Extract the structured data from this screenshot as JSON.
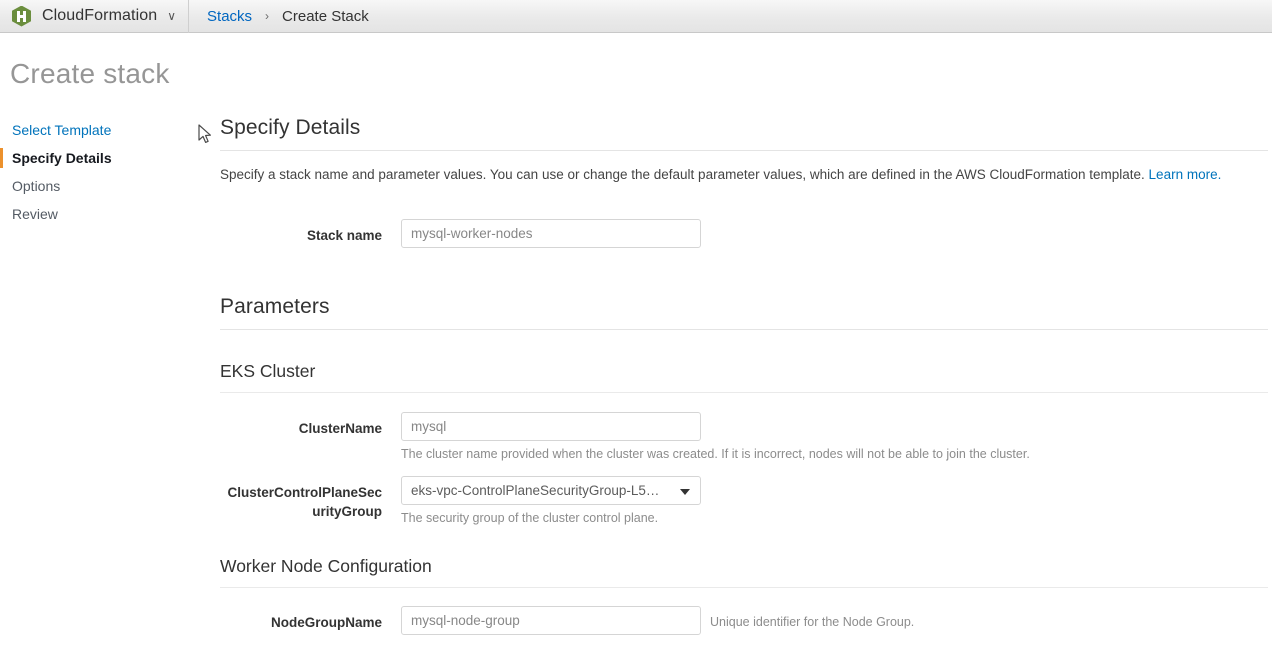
{
  "topbar": {
    "service_icon": "cloudformation-icon",
    "service_name": "CloudFormation",
    "service_caret": "∨",
    "breadcrumb": {
      "root_label": "Stacks",
      "separator": "›",
      "current_label": "Create Stack"
    }
  },
  "page": {
    "title": "Create stack"
  },
  "sidebar": {
    "items": [
      {
        "label": "Select Template",
        "state": "link"
      },
      {
        "label": "Specify Details",
        "state": "active"
      },
      {
        "label": "Options",
        "state": "normal"
      },
      {
        "label": "Review",
        "state": "normal"
      }
    ]
  },
  "main": {
    "section_title": "Specify Details",
    "intro_text": "Specify a stack name and parameter values. You can use or change the default parameter values, which are defined in the AWS CloudFormation template. ",
    "intro_link": "Learn more.",
    "stack_name": {
      "label": "Stack name",
      "value": "mysql-worker-nodes"
    },
    "parameters_title": "Parameters",
    "groups": [
      {
        "title": "EKS Cluster",
        "fields": [
          {
            "label": "ClusterName",
            "type": "text",
            "value": "mysql",
            "help": "The cluster name provided when the cluster was created. If it is incorrect, nodes will not be able to join the cluster.",
            "help_position": "below"
          },
          {
            "label": "ClusterControlPlaneSecurityGroup",
            "type": "select",
            "value": "eks-vpc-ControlPlaneSecurityGroup-L5…",
            "help": "The security group of the cluster control plane.",
            "help_position": "below"
          }
        ]
      },
      {
        "title": "Worker Node Configuration",
        "fields": [
          {
            "label": "NodeGroupName",
            "type": "text",
            "value": "mysql-node-group",
            "help": "Unique identifier for the Node Group.",
            "help_position": "right"
          }
        ]
      }
    ]
  },
  "colors": {
    "link": "#0073bb",
    "breadcrumb_link": "#0066c0",
    "accent_active": "#ec912d",
    "service_icon": "#6b8e3e",
    "text": "#333333",
    "muted": "#8c8c8c"
  }
}
